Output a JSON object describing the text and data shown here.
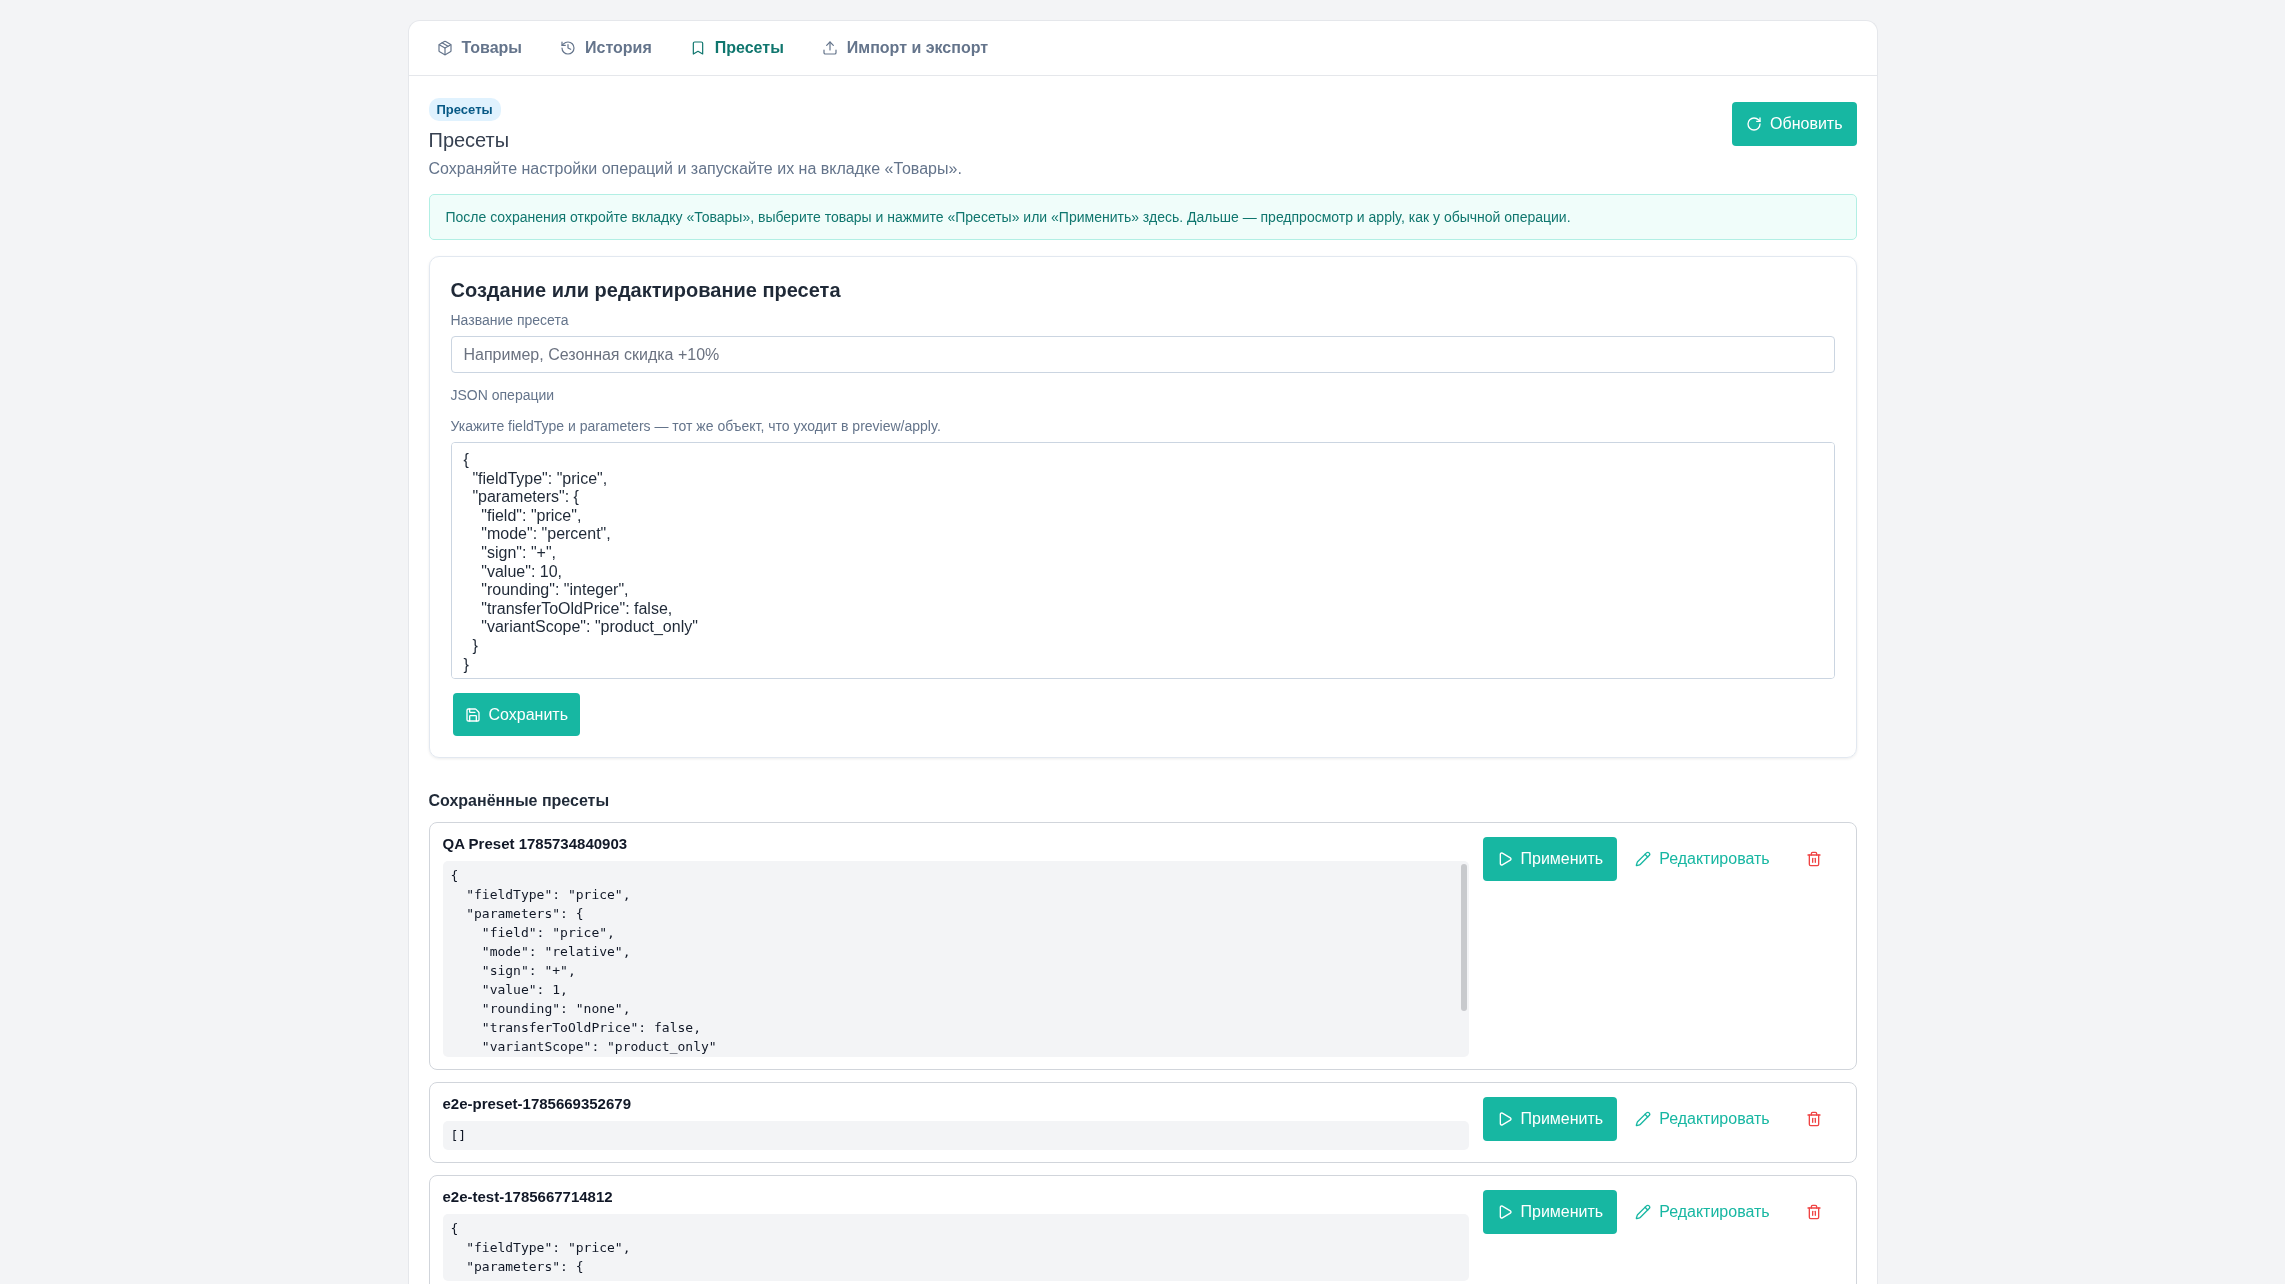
{
  "tabs": [
    {
      "label": "Товары",
      "selected": false
    },
    {
      "label": "История",
      "selected": false
    },
    {
      "label": "Пресеты",
      "selected": true
    },
    {
      "label": "Импорт и экспорт",
      "selected": false
    }
  ],
  "header": {
    "badge": "Пресеты",
    "title": "Пресеты",
    "subtitle": "Сохраняйте настройки операций и запускайте их на вкладке «Товары».",
    "refresh_button": "Обновить"
  },
  "info": "После сохранения откройте вкладку «Товары», выберите товары и нажмите «Пресеты» или «Применить» здесь. Дальше — предпросмотр и apply, как у обычной операции.",
  "form": {
    "title": "Создание или редактирование пресета",
    "name_label": "Название пресета",
    "name_placeholder": "Например, Сезонная скидка +10%",
    "json_label": "JSON операции",
    "json_hint": "Укажите fieldType и parameters — тот же объект, что уходит в preview/apply.",
    "json_value": "{\n  \"fieldType\": \"price\",\n  \"parameters\": {\n    \"field\": \"price\",\n    \"mode\": \"percent\",\n    \"sign\": \"+\",\n    \"value\": 10,\n    \"rounding\": \"integer\",\n    \"transferToOldPrice\": false,\n    \"variantScope\": \"product_only\"\n  }\n}",
    "save_button": "Сохранить"
  },
  "saved": {
    "title": "Сохранённые пресеты",
    "presets": [
      {
        "name": "QA Preset 1785734840903",
        "apply_label": "Применить",
        "edit_label": "Редактировать",
        "code": "{\n  \"fieldType\": \"price\",\n  \"parameters\": {\n    \"field\": \"price\",\n    \"mode\": \"relative\",\n    \"sign\": \"+\",\n    \"value\": 1,\n    \"rounding\": \"none\",\n    \"transferToOldPrice\": false,\n    \"variantScope\": \"product_only\"",
        "scrollable": true
      },
      {
        "name": "e2e-preset-1785669352679",
        "apply_label": "Применить",
        "edit_label": "Редактировать",
        "code": "[]",
        "scrollable": false
      },
      {
        "name": "e2e-test-1785667714812",
        "apply_label": "Применить",
        "edit_label": "Редактировать",
        "code": "{\n  \"fieldType\": \"price\",\n  \"parameters\": {",
        "scrollable": false
      }
    ]
  }
}
